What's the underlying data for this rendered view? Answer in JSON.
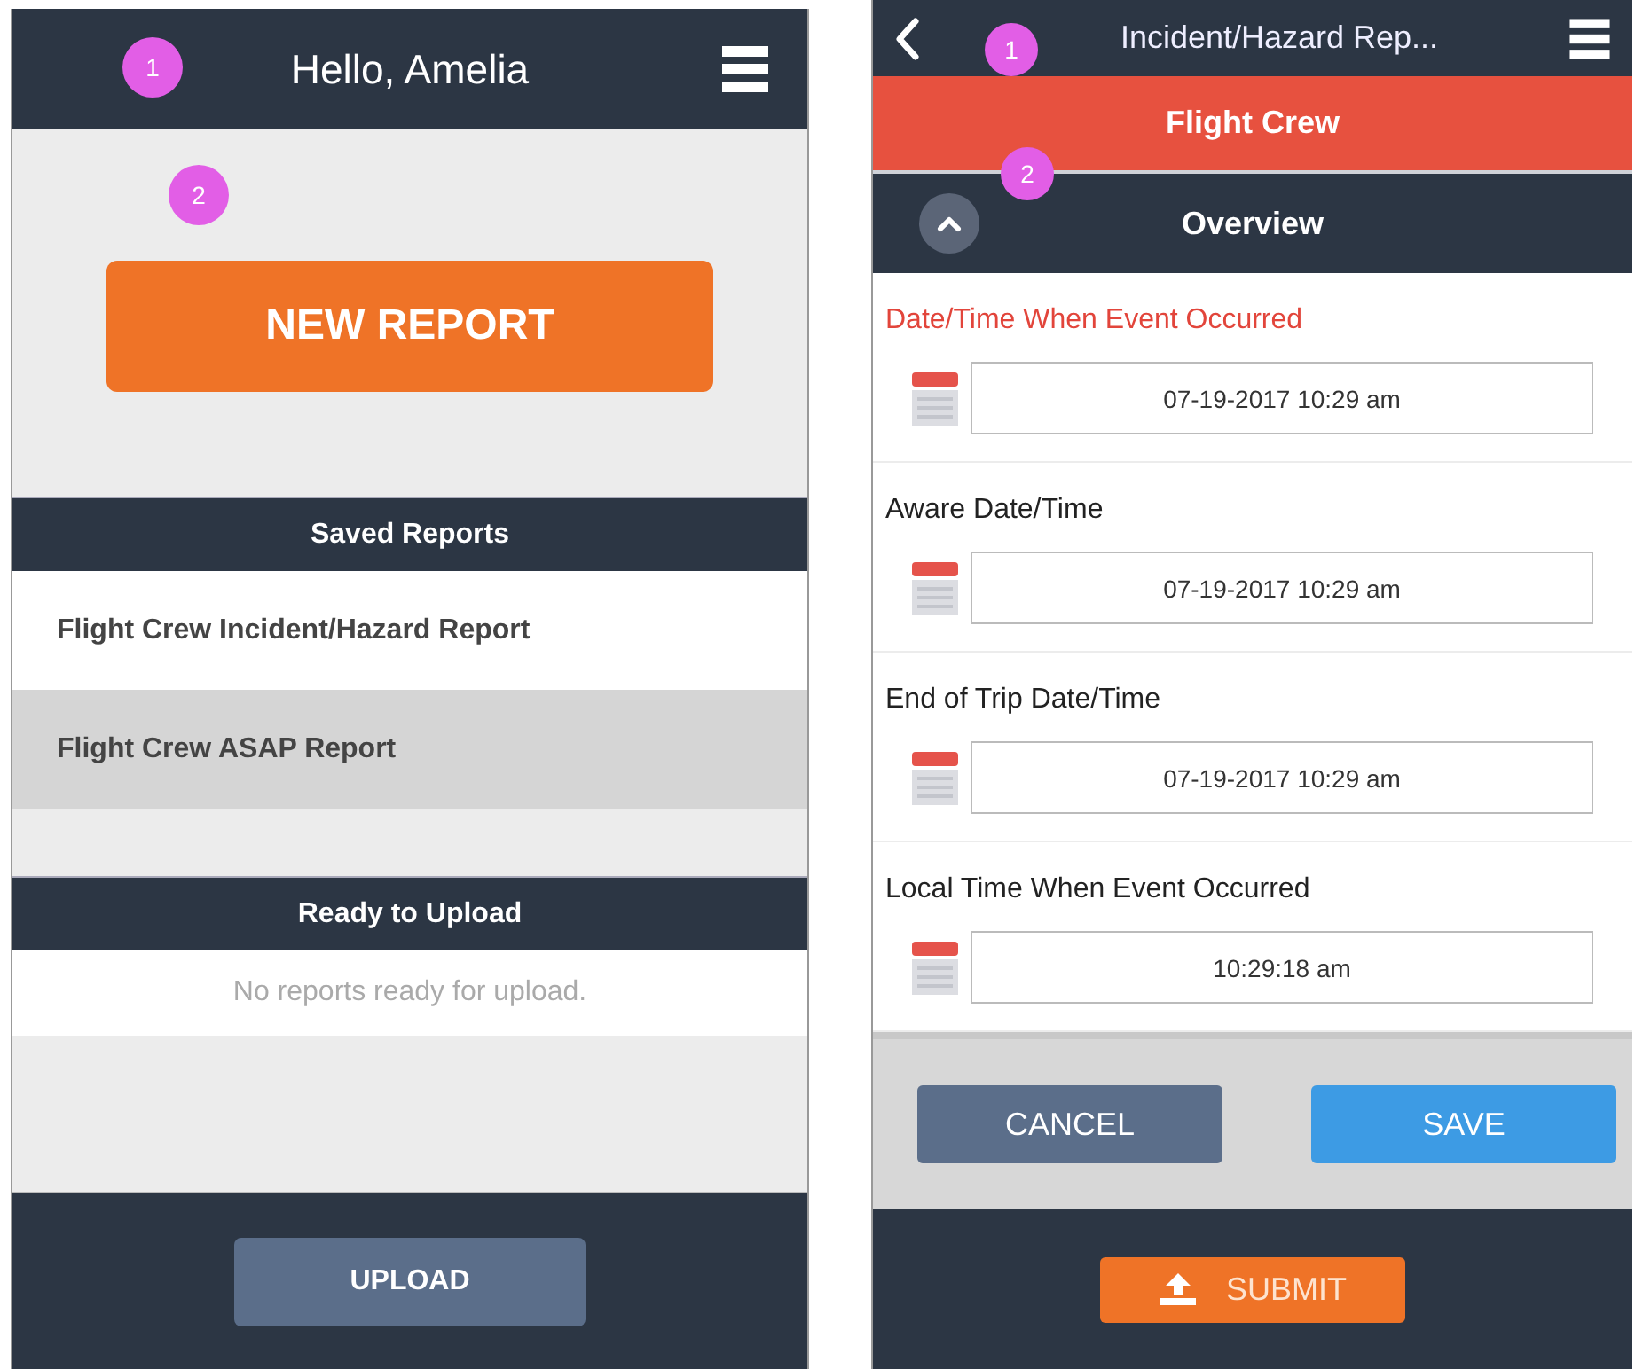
{
  "home_screen": {
    "header": {
      "title": "Hello, Amelia"
    },
    "annotations": [
      "1",
      "2"
    ],
    "new_report_button": "NEW REPORT",
    "saved_reports": {
      "title": "Saved Reports",
      "items": [
        {
          "label": "Flight Crew Incident/Hazard Report",
          "selected": false
        },
        {
          "label": "Flight Crew ASAP Report",
          "selected": true
        }
      ]
    },
    "ready_to_upload": {
      "title": "Ready to Upload",
      "empty_message": "No reports ready for upload."
    },
    "upload_button": "UPLOAD"
  },
  "report_screen": {
    "header": {
      "title": "Incident/Hazard Rep..."
    },
    "annotations": [
      "1",
      "2"
    ],
    "category": "Flight Crew",
    "section": {
      "title": "Overview",
      "expanded": true
    },
    "fields": [
      {
        "label": "Date/Time When Event Occurred",
        "value": "07-19-2017 10:29 am",
        "error": true
      },
      {
        "label": "Aware Date/Time",
        "value": "07-19-2017 10:29 am",
        "error": false
      },
      {
        "label": "End of Trip Date/Time",
        "value": "07-19-2017 10:29 am",
        "error": false
      },
      {
        "label": "Local Time When Event Occurred",
        "value": "10:29:18 am",
        "error": false
      }
    ],
    "cancel_button": "CANCEL",
    "save_button": "SAVE",
    "submit_button": "SUBMIT"
  }
}
